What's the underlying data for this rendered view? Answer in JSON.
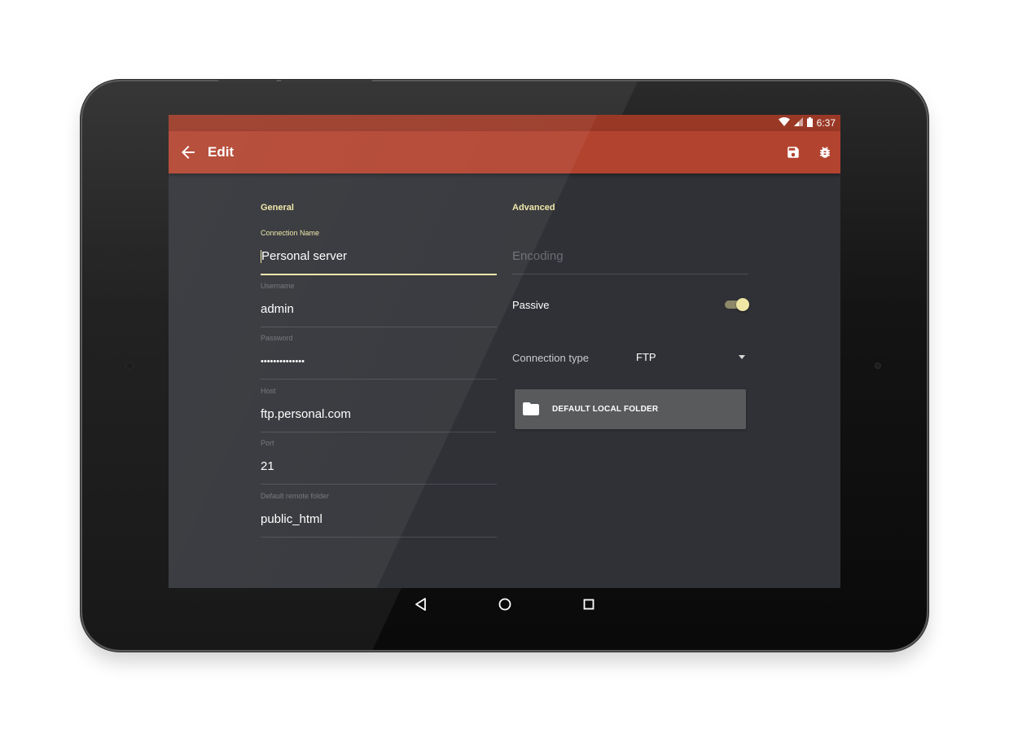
{
  "status_bar": {
    "time": "6:37"
  },
  "toolbar": {
    "title": "Edit",
    "back_icon": "arrow-back-icon",
    "actions": [
      {
        "icon": "save-icon"
      },
      {
        "icon": "bug-icon"
      }
    ]
  },
  "general": {
    "heading": "General",
    "fields": [
      {
        "label": "Connection Name",
        "value": "Personal server"
      },
      {
        "label": "Username",
        "value": "admin"
      },
      {
        "label": "Password",
        "value": "••••••••••••••"
      },
      {
        "label": "Host",
        "value": "ftp.personal.com"
      },
      {
        "label": "Port",
        "value": "21"
      },
      {
        "label": "Default remote folder",
        "value": "public_html"
      }
    ]
  },
  "advanced": {
    "heading": "Advanced",
    "encoding_placeholder": "Encoding",
    "passive_label": "Passive",
    "passive_on": true,
    "connection_type_label": "Connection type",
    "connection_type_value": "FTP",
    "local_folder_button": "DEFAULT LOCAL FOLDER"
  },
  "colors": {
    "accent": "#efe6a6",
    "toolbar": "#b2432f",
    "status_bar": "#9a3826",
    "background": "#2f3136"
  },
  "navigation": {
    "icons": [
      "back-triangle-icon",
      "home-circle-icon",
      "recents-square-icon"
    ]
  }
}
